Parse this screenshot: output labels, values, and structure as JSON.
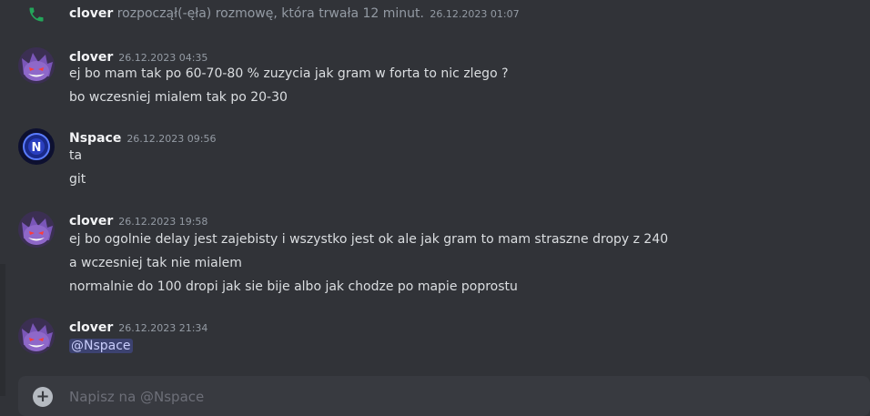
{
  "system": {
    "user": "clover",
    "text": " rozpoczął(-ęła) rozmowę, która trwała 12 minut.",
    "timestamp": "26.12.2023 01:07"
  },
  "messages": [
    {
      "user": "clover",
      "time": "26.12.2023 04:35",
      "avatar": "gengar-avatar",
      "lines": [
        "ej bo mam tak po 60-70-80 % zuzycia jak gram w forta to nic zlego ?",
        "bo wczesniej mialem tak po 20-30"
      ]
    },
    {
      "user": "Nspace",
      "time": "26.12.2023 09:56",
      "avatar": "nspace-avatar",
      "lines": [
        "ta",
        "git"
      ]
    },
    {
      "user": "clover",
      "time": "26.12.2023 19:58",
      "avatar": "gengar-avatar",
      "lines": [
        "ej bo ogolnie delay jest zajebisty i wszystko jest ok ale jak gram to mam straszne dropy z 240",
        "a wczesniej tak nie mialem",
        "normalnie do 100 dropi jak sie bije albo jak chodze po mapie poprostu"
      ]
    },
    {
      "user": "clover",
      "time": "26.12.2023 21:34",
      "avatar": "gengar-avatar",
      "mention": "@Nspace"
    }
  ],
  "input": {
    "placeholder": "Napisz na @Nspace"
  },
  "colors": {
    "background": "#313338",
    "mention_bg": "#3c4270",
    "call_green": "#23a55a"
  }
}
